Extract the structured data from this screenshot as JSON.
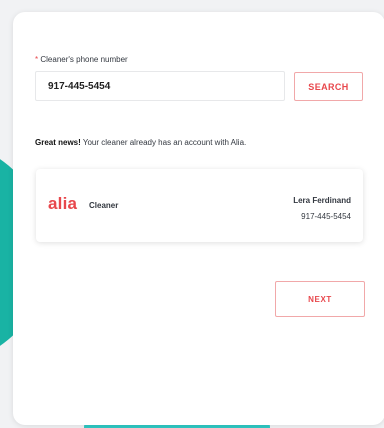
{
  "form": {
    "required_mark": "*",
    "phone_label": "Cleaner's phone number",
    "phone_value": "917-445-5454",
    "search_label": "SEARCH"
  },
  "notice": {
    "emphasis": "Great news!",
    "message": " Your cleaner already has an account with Alia."
  },
  "account": {
    "brand": "alia",
    "role": "Cleaner",
    "name": "Lera Ferdinand",
    "phone": "917-445-5454"
  },
  "actions": {
    "next_label": "NEXT"
  },
  "colors": {
    "accent": "#e8474c",
    "teal": "#19b3a4"
  }
}
